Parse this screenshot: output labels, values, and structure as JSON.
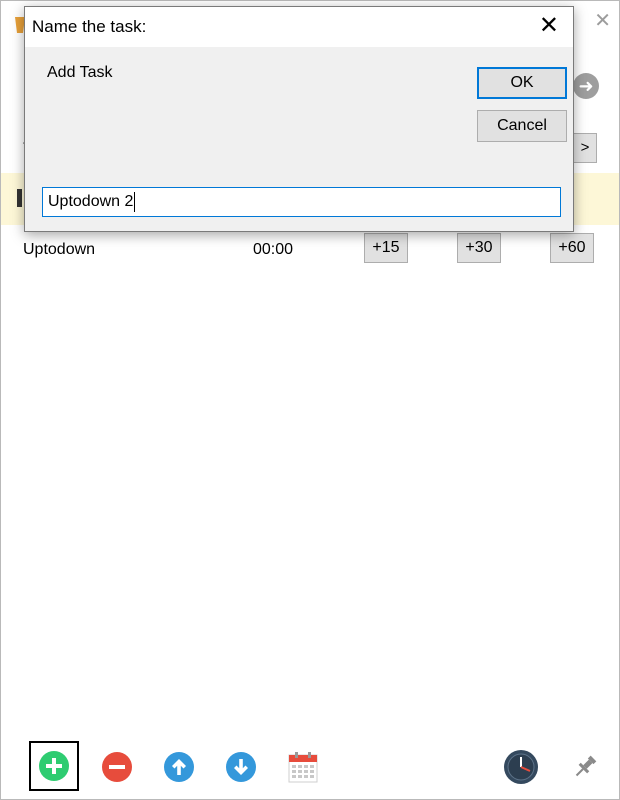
{
  "dialog": {
    "title": "Name the task:",
    "prompt": "Add Task",
    "ok_label": "OK",
    "cancel_label": "Cancel",
    "input_value": "Uptodown 2"
  },
  "background": {
    "partial_label": "T",
    "next_label": ">",
    "task": {
      "name": "Uptodown",
      "time": "00:00",
      "increments": [
        "+15",
        "+30",
        "+60"
      ]
    }
  },
  "toolbar": {
    "icons": [
      "add-icon",
      "remove-icon",
      "move-up-icon",
      "move-down-icon",
      "calendar-icon",
      "clock-icon",
      "pin-icon"
    ]
  },
  "colors": {
    "accent": "#0078d7",
    "add": "#2ecc71",
    "remove": "#e74c3c",
    "arrows": "#3498db",
    "highlight_row": "#fdf7d7"
  }
}
